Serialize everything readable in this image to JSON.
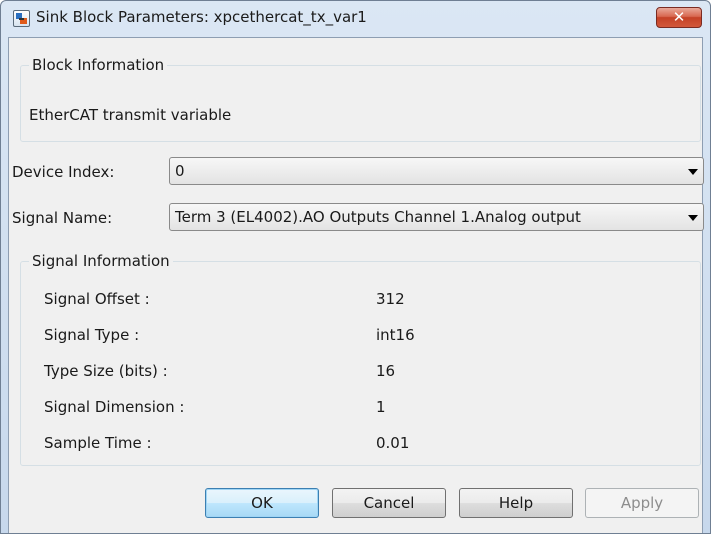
{
  "window": {
    "title": "Sink Block Parameters: xpcethercat_tx_var1",
    "close_label": "✕"
  },
  "block_info": {
    "legend": "Block Information",
    "description": "EtherCAT transmit variable"
  },
  "device_index": {
    "label": "Device Index:",
    "value": "0"
  },
  "signal_name": {
    "label": "Signal Name:",
    "value": "Term 3 (EL4002).AO Outputs Channel 1.Analog output"
  },
  "signal_info": {
    "legend": "Signal Information",
    "rows": [
      {
        "label": "Signal Offset :",
        "value": "312"
      },
      {
        "label": "Signal Type :",
        "value": "int16"
      },
      {
        "label": "Type Size (bits) :",
        "value": "16"
      },
      {
        "label": "Signal Dimension :",
        "value": "1"
      },
      {
        "label": "Sample Time :",
        "value": "0.01"
      }
    ]
  },
  "buttons": {
    "ok": "OK",
    "cancel": "Cancel",
    "help": "Help",
    "apply": "Apply"
  }
}
